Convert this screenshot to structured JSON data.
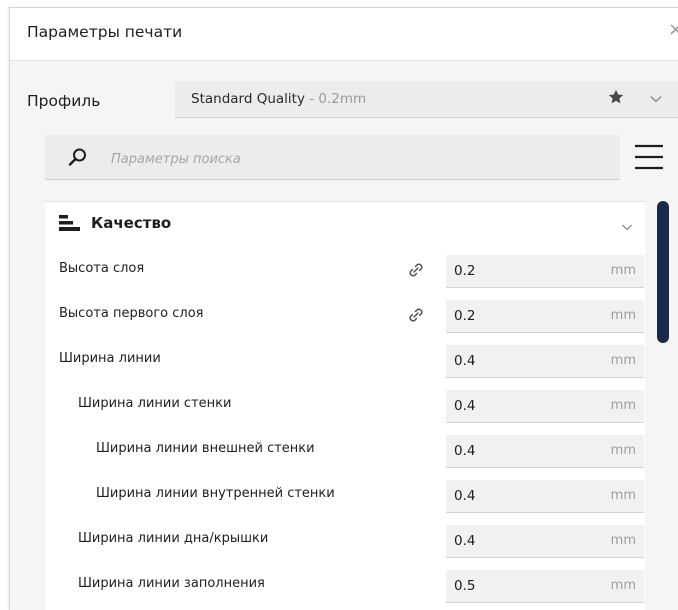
{
  "window": {
    "title": "Параметры печати",
    "close_glyph": "×"
  },
  "profile": {
    "label": "Профиль",
    "name": "Standard Quality",
    "layer": " - 0.2mm",
    "favorite_icon": "star-icon",
    "dropdown_icon": "chevron-down-icon"
  },
  "search": {
    "placeholder": "Параметры поиска",
    "value": ""
  },
  "category": {
    "label": "Качество",
    "icon": "quality-icon"
  },
  "settings": [
    {
      "label": "Высота слоя",
      "value": "0.2",
      "unit": "mm",
      "indent": 0,
      "linked": true
    },
    {
      "label": "Высота первого слоя",
      "value": "0.2",
      "unit": "mm",
      "indent": 0,
      "linked": true
    },
    {
      "label": "Ширина линии",
      "value": "0.4",
      "unit": "mm",
      "indent": 0,
      "linked": false
    },
    {
      "label": "Ширина линии стенки",
      "value": "0.4",
      "unit": "mm",
      "indent": 1,
      "linked": false
    },
    {
      "label": "Ширина линии внешней стенки",
      "value": "0.4",
      "unit": "mm",
      "indent": 2,
      "linked": false
    },
    {
      "label": "Ширина линии внутренней стенки",
      "value": "0.4",
      "unit": "mm",
      "indent": 2,
      "linked": false
    },
    {
      "label": "Ширина линии дна/крышки",
      "value": "0.4",
      "unit": "mm",
      "indent": 1,
      "linked": false
    },
    {
      "label": "Ширина линии заполнения",
      "value": "0.5",
      "unit": "mm",
      "indent": 1,
      "linked": false
    }
  ],
  "colors": {
    "scrollbar": "#1a2b4a",
    "panel_bg": "#f5f5f5",
    "field_bg": "#f1f1f1"
  }
}
